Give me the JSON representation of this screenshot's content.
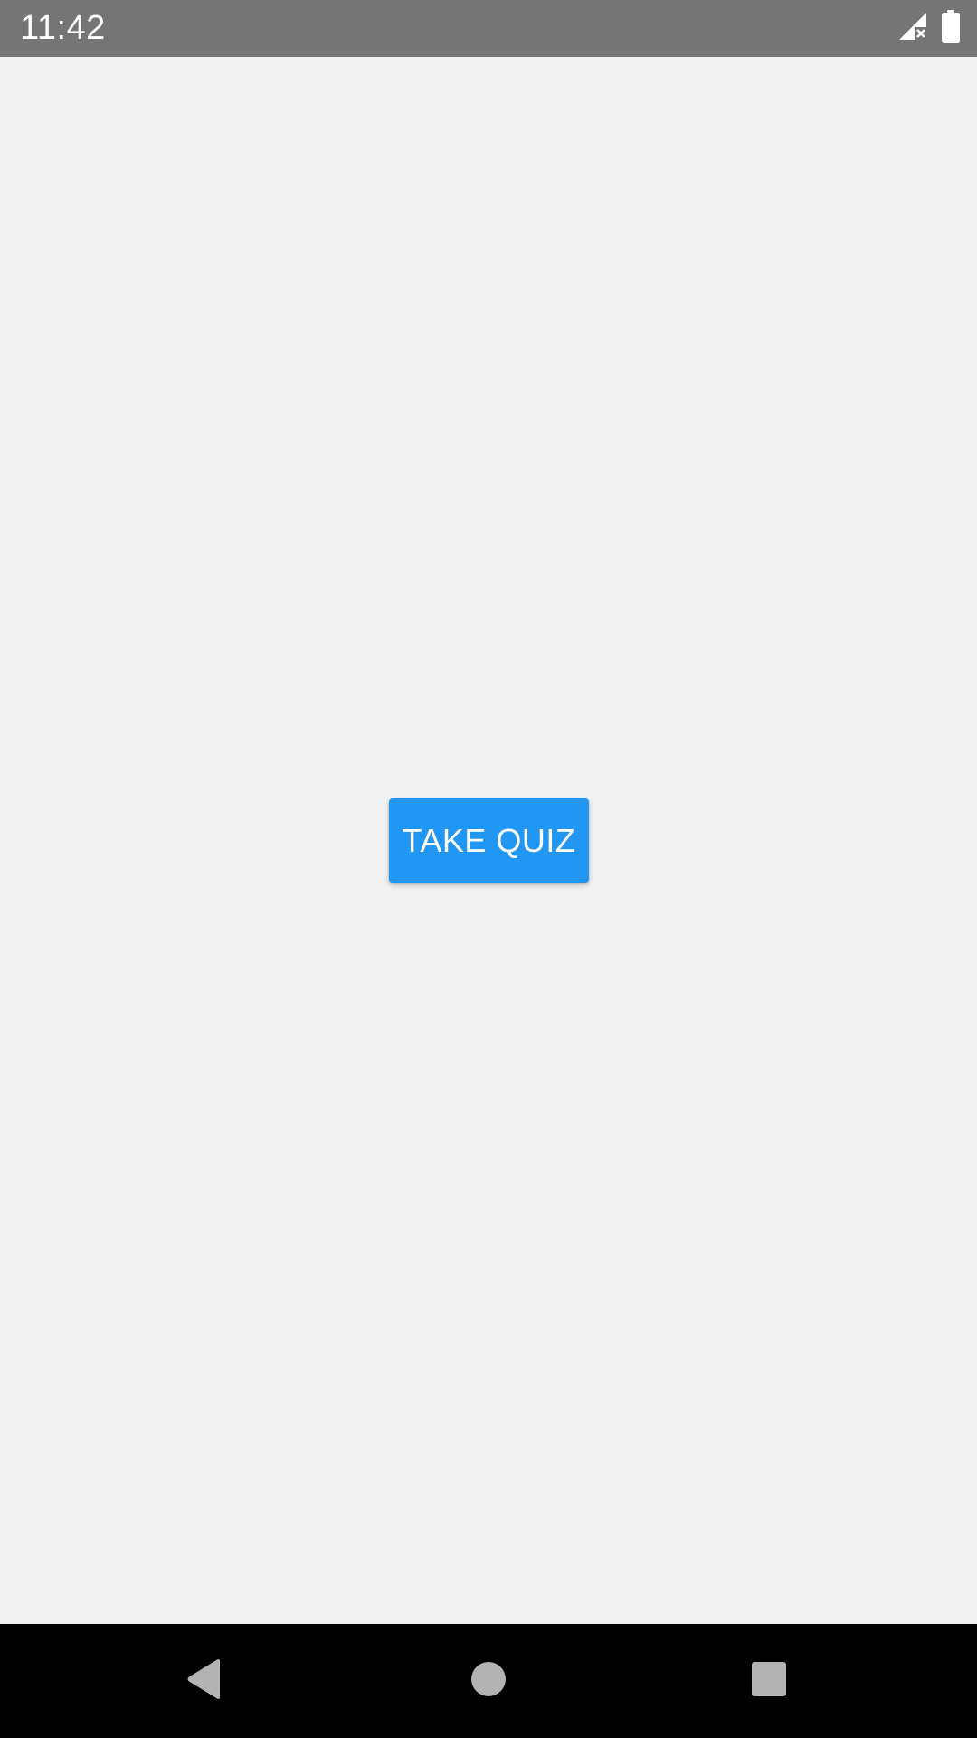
{
  "status_bar": {
    "time": "11:42",
    "icons": [
      "signal-no-connection-icon",
      "battery-full-icon"
    ]
  },
  "main": {
    "take_quiz_label": "TAKE QUIZ"
  },
  "nav_bar": {
    "buttons": [
      "back-icon",
      "home-icon",
      "recents-icon"
    ]
  },
  "colors": {
    "status_bar_bg": "#757575",
    "background": "#f2f2f2",
    "button_primary": "#2196f3",
    "button_text": "#ffffff",
    "nav_bar_bg": "#000000",
    "nav_icon": "#b3b3b3"
  }
}
